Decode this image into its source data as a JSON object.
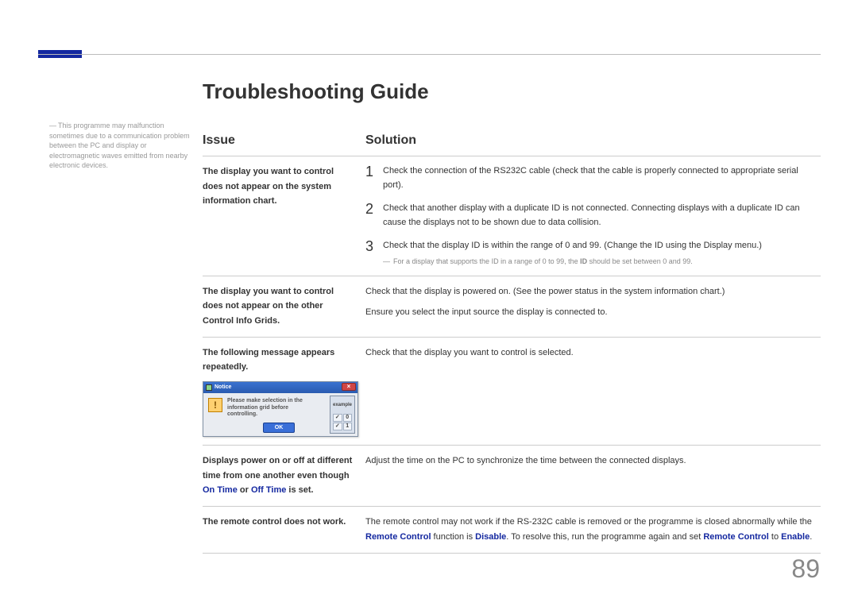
{
  "title": "Troubleshooting Guide",
  "sideNote": "This programme may malfunction sometimes due to a communication problem between the PC and display or electromagnetic waves emitted from nearby electronic devices.",
  "headers": {
    "issue": "Issue",
    "solution": "Solution"
  },
  "rows": {
    "r1": {
      "issue": "The display you want to control does not appear on the system information chart.",
      "n1": "1",
      "s1": "Check the connection of the RS232C cable (check that the cable is properly connected to appropriate serial port).",
      "n2": "2",
      "s2": "Check that another display with a duplicate ID is not connected. Connecting displays with a duplicate ID can cause the displays not to be shown due to data collision.",
      "n3": "3",
      "s3": "Check that the display ID is within the range of 0 and 99. (Change the ID using the Display menu.)",
      "footP1": "For a display that supports the ID in a range of 0 to 99, the ",
      "footBold": "ID",
      "footP2": " should be set between 0 and 99."
    },
    "r2": {
      "issue": "The display you want to control does not appear on the other Control Info Grids.",
      "s1": "Check that the display is powered on. (See the power status in the system information chart.)",
      "s2": "Ensure you select the input source the display is connected to."
    },
    "r3": {
      "issue": "The following message appears repeatedly.",
      "solution": "Check that the display you want to control is selected.",
      "dialog": {
        "title": "Notice",
        "msg": "Please make selection in the information grid before controlling.",
        "ok": "OK",
        "example": "example",
        "close": "×",
        "warn": "!"
      }
    },
    "r4": {
      "iP1": "Displays power on or off at different time from one another even though ",
      "iB1": "On Time",
      "iP2": " or ",
      "iB2": "Off Time",
      "iP3": " is set.",
      "solution": "Adjust the time on the PC to synchronize the time between the connected displays."
    },
    "r5": {
      "issue": "The remote control does not work.",
      "sP1": "The remote control may not work if the RS-232C cable is removed or the programme is closed abnormally while the ",
      "sB1": "Remote Control",
      "sP2": " function is ",
      "sB2": "Disable",
      "sP3": ". To resolve this, run the programme again and set ",
      "sB3": "Remote Control",
      "sP4": " to ",
      "sB4": "Enable",
      "sP5": "."
    }
  },
  "pageNumber": "89"
}
